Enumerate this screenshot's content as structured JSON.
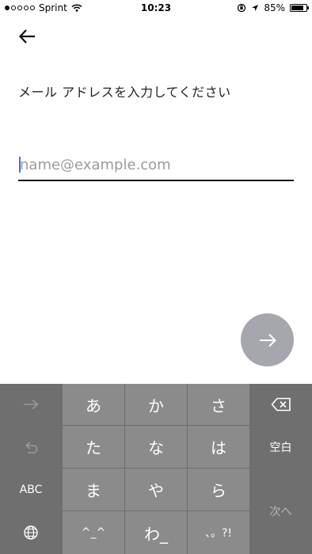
{
  "status_bar": {
    "carrier": "Sprint",
    "time": "10:23",
    "battery": "85%",
    "battery_level": 0.85
  },
  "nav": {
    "back_icon": "arrow-left-icon"
  },
  "page": {
    "heading": "メール アドレスを入力してください",
    "email_placeholder": "name@example.com",
    "email_value": ""
  },
  "actions": {
    "next_icon": "arrow-right-icon"
  },
  "keyboard": {
    "row1": [
      "あ",
      "か",
      "さ"
    ],
    "row2": [
      "た",
      "な",
      "は"
    ],
    "row3": [
      "ま",
      "や",
      "ら"
    ],
    "row4": [
      "^_^",
      "わ_",
      "、。?!"
    ],
    "abc_label": "ABC",
    "space_label": "空白",
    "next_label": "次へ",
    "icons": {
      "arrow": "arrow-right-icon",
      "undo": "undo-icon",
      "globe": "globe-icon",
      "delete": "delete-icon"
    },
    "colors": {
      "side": "#6f6f6f",
      "main": "#8b8b8b",
      "fab": "#a6a6ad"
    }
  }
}
